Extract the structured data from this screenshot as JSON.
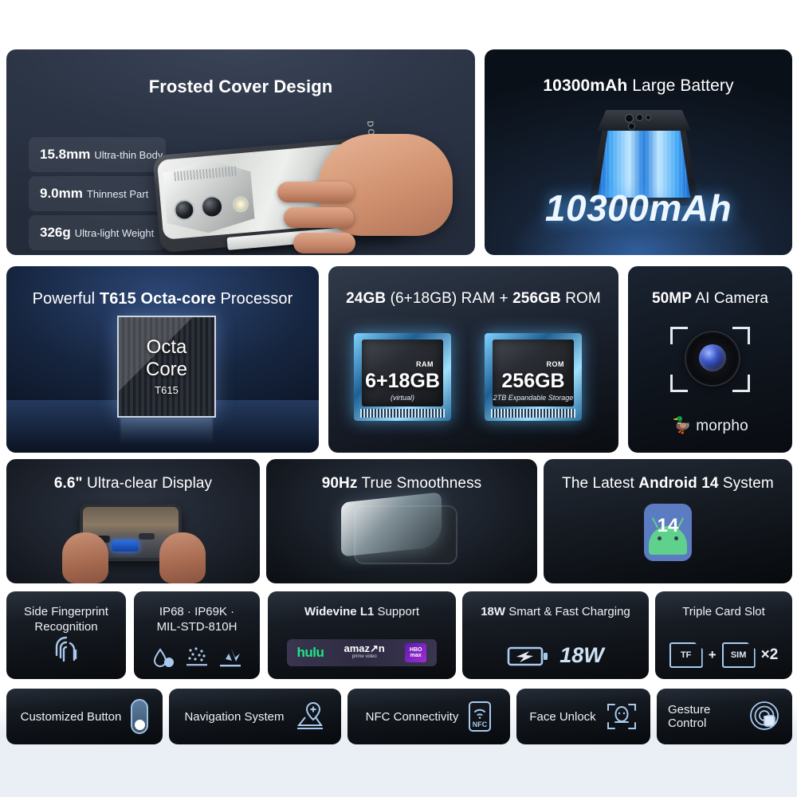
{
  "page": {
    "background_color": "#ffffff",
    "footer_band_color": "#eaeef5"
  },
  "panels": {
    "frosted": {
      "title_plain": "Frosted Cover Design",
      "title": "Frosted Cover Design",
      "phone_brand": "DOOGEE",
      "specs": [
        {
          "value": "15.8mm",
          "label": "Ultra-thin Body"
        },
        {
          "value": "9.0mm",
          "label": "Thinnest Part"
        },
        {
          "value": "326g",
          "label": "Ultra-light Weight"
        }
      ]
    },
    "battery": {
      "title_bold": "10300mAh",
      "title_rest": " Large Battery",
      "big_text": "10300mAh"
    },
    "processor": {
      "title_pre": "Powerful ",
      "title_bold": "T615 Octa-core",
      "title_post": " Processor",
      "chip_line1": "Octa",
      "chip_line2": "Core",
      "chip_line3": "T615"
    },
    "memory": {
      "title_a": "24GB",
      "title_b": " (6+18GB) RAM + ",
      "title_c": "256GB",
      "title_d": " ROM",
      "ram_chip": {
        "kind": "RAM",
        "value": "6+18GB",
        "sub": "(virtual)"
      },
      "rom_chip": {
        "kind": "ROM",
        "value": "256GB",
        "sub": "2TB Expandable Storage"
      }
    },
    "camera": {
      "title_bold": "50MP",
      "title_rest": " AI Camera",
      "brand": "morpho"
    },
    "display": {
      "title_bold": "6.6\"",
      "title_rest": " Ultra-clear Display"
    },
    "refresh": {
      "title_bold": "90Hz",
      "title_rest": " True Smoothness"
    },
    "android": {
      "title_pre": "The Latest ",
      "title_bold": "Android 14",
      "title_post": " System",
      "badge_number": "14"
    }
  },
  "tiles": [
    {
      "key": "fingerprint",
      "title": "Side Fingerprint Recognition",
      "icon": "fingerprint-icon"
    },
    {
      "key": "rugged",
      "title_line1": "IP68 · IP69K ·",
      "title_line2": "MIL-STD-810H",
      "icons": [
        "water-drop-icon",
        "dust-icon",
        "drop-impact-icon"
      ]
    },
    {
      "key": "widevine",
      "title_bold": "Widevine L1",
      "title_rest": " Support",
      "logos": [
        "hulu",
        "amazon prime video",
        "HBO max"
      ]
    },
    {
      "key": "charging",
      "title_bold": "18W",
      "title_rest": " Smart & Fast Charging",
      "icon": "battery-bolt-icon",
      "value": "18W"
    },
    {
      "key": "cards",
      "title": "Triple Card Slot",
      "card_a": "TF",
      "plus": "+",
      "card_b": "SIM",
      "multiplier": "×2"
    }
  ],
  "pills": [
    {
      "key": "custom",
      "label": "Customized Button",
      "icon": "toggle-switch-icon"
    },
    {
      "key": "nav",
      "label": "Navigation System",
      "icon": "map-pin-icon"
    },
    {
      "key": "nfc",
      "label": "NFC Connectivity",
      "icon": "nfc-icon",
      "icon_text": "NFC"
    },
    {
      "key": "face",
      "label": "Face Unlock",
      "icon": "face-scan-icon"
    },
    {
      "key": "gesture",
      "label": "Gesture Control",
      "icon": "gesture-tap-icon"
    }
  ],
  "colors": {
    "accent_blue": "#b9d4f2",
    "android_green": "#5fd18c",
    "android_blue": "#5b7cc0",
    "hulu_green": "#1ce783",
    "battery_glow": "#46a0ff"
  }
}
